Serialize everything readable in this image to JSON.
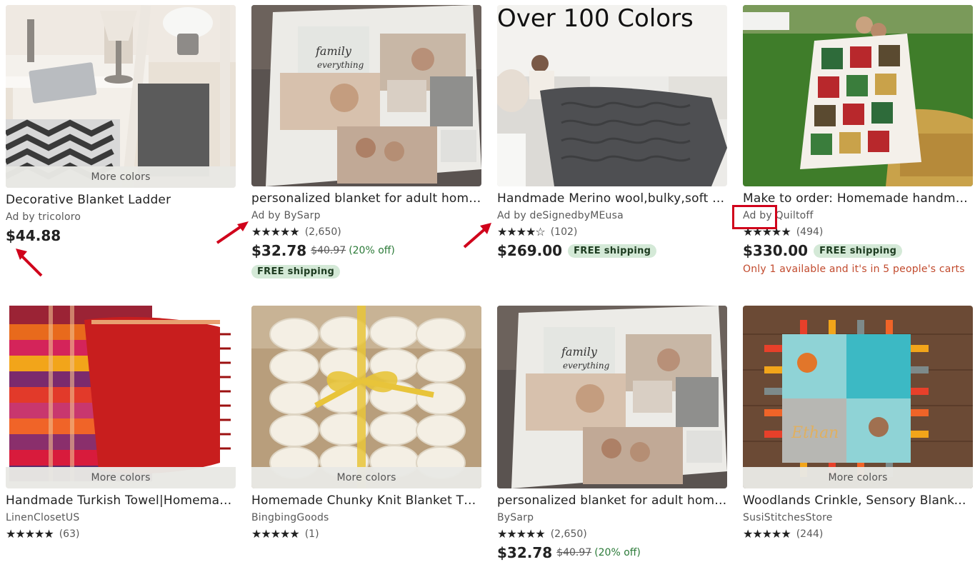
{
  "more_colors_label": "More colors",
  "free_shipping_label": "FREE shipping",
  "colors": {
    "star": "#222222",
    "discount": "#2b7a38",
    "badge_bg": "#d4e9d7",
    "scarcity": "#c24b2e",
    "annotation": "#d0021b"
  },
  "cards": [
    {
      "title": "Decorative Blanket Ladder",
      "shop": "Ad by tricoloro",
      "price": "$44.88",
      "more_colors": true
    },
    {
      "title": "personalized blanket for adult home...",
      "shop": "Ad by BySarp",
      "stars": "★★★★★",
      "count": "(2,650)",
      "price": "$32.78",
      "original": "$40.97",
      "discount": "(20% off)",
      "free_shipping": true
    },
    {
      "title": "Handmade Merino wool,bulky,soft L...",
      "shop": "Ad by deSignedbyMEusa",
      "stars": "★★★★☆",
      "count": "(102)",
      "price": "$269.00",
      "free_shipping": true,
      "image_text": "Over 100 Colors"
    },
    {
      "title": "Make to order: Homemade handmad...",
      "shop": "Ad by Quiltoff",
      "stars": "★★★★★",
      "count": "(494)",
      "price": "$330.00",
      "free_shipping": true,
      "scarcity": "Only 1 available and it's in 5 people's carts"
    },
    {
      "title": "Handmade Turkish Towel|Homemad...",
      "shop": "LinenClosetUS",
      "stars": "★★★★★",
      "count": "(63)",
      "more_colors": true
    },
    {
      "title": "Homemade Chunky Knit Blanket Thr...",
      "shop": "BingbingGoods",
      "stars": "★★★★★",
      "count": "(1)",
      "more_colors": true
    },
    {
      "title": "personalized blanket for adult home...",
      "shop": "BySarp",
      "stars": "★★★★★",
      "count": "(2,650)",
      "price": "$32.78",
      "original": "$40.97",
      "discount": "(20% off)"
    },
    {
      "title": "Woodlands Crinkle, Sensory Blanket,...",
      "shop": "SusiStitchesStore",
      "stars": "★★★★★",
      "count": "(244)",
      "more_colors": true,
      "image_text": "Ethan"
    }
  ]
}
